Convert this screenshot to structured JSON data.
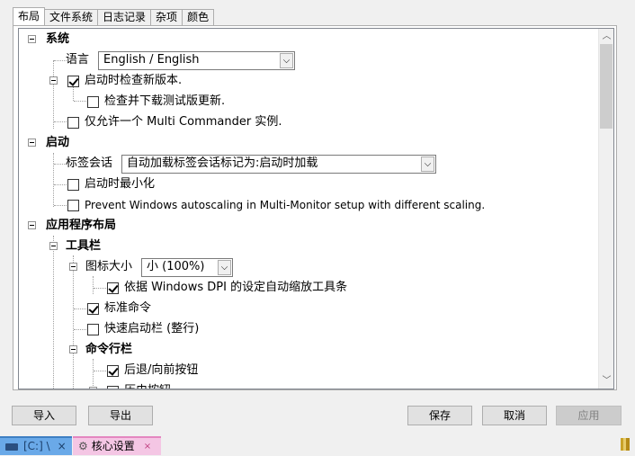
{
  "tabs": [
    "布局",
    "文件系统",
    "日志记录",
    "杂项",
    "颜色"
  ],
  "tree": {
    "system": "系统",
    "language_label": "语言",
    "language_value": "English / English",
    "check_updates": "启动时检查新版本.",
    "check_beta": "检查并下载测试版更新.",
    "single_instance": "仅允许一个 Multi Commander 实例.",
    "startup": "启动",
    "tab_session_label": "标签会话",
    "tab_session_value": "自动加载标签会话标记为:启动时加载",
    "start_minimized": "启动时最小化",
    "prevent_autoscaling": "Prevent Windows autoscaling in Multi-Monitor setup with different scaling.",
    "app_layout": "应用程序布局",
    "toolbar": "工具栏",
    "icon_size_label": "图标大小",
    "icon_size_value": "小 (100%)",
    "auto_scale_dpi": "依据 Windows DPI 的设定自动缩放工具条",
    "standard_commands": "标准命令",
    "quick_launch": "快速启动栏 (整行)",
    "command_bar": "命令行栏",
    "back_forward": "后退/向前按钮",
    "history": "历史按钮"
  },
  "buttons": {
    "import": "导入",
    "export": "导出",
    "save": "保存",
    "cancel": "取消",
    "apply": "应用"
  },
  "status": {
    "tab1": "[C:] \\",
    "tab2": "核心设置",
    "close": "×"
  }
}
